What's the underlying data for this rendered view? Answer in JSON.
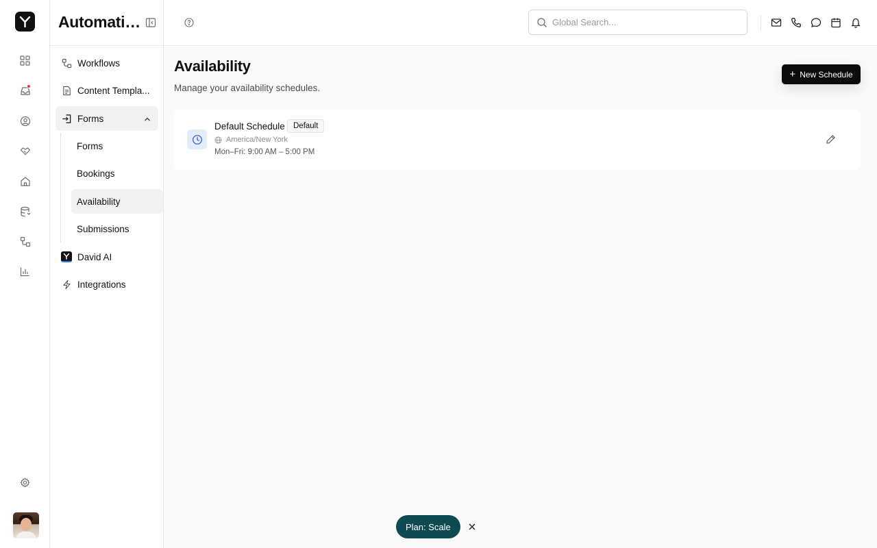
{
  "app": {
    "section_title": "Automatio..."
  },
  "rail": {
    "items": [
      {
        "icon": "dashboard-icon"
      },
      {
        "icon": "inbox-icon",
        "has_notification": true
      },
      {
        "icon": "contacts-icon"
      },
      {
        "icon": "deals-icon"
      },
      {
        "icon": "home-icon"
      },
      {
        "icon": "database-icon"
      },
      {
        "icon": "automation-icon"
      },
      {
        "icon": "reports-icon"
      }
    ],
    "settings_icon": "gear-icon"
  },
  "sidebar": {
    "items": [
      {
        "label": "Workflows",
        "icon": "workflow-icon"
      },
      {
        "label": "Content Templa...",
        "icon": "document-icon"
      },
      {
        "label": "Forms",
        "icon": "form-import-icon",
        "expanded": true
      },
      {
        "label": "David AI",
        "icon": "david-ai-logo-icon"
      },
      {
        "label": "Integrations",
        "icon": "lightning-icon"
      }
    ],
    "forms_children": [
      {
        "label": "Forms"
      },
      {
        "label": "Bookings"
      },
      {
        "label": "Availability",
        "active": true
      },
      {
        "label": "Submissions"
      }
    ]
  },
  "header": {
    "search_placeholder": "Global Search...",
    "icons": [
      "mail-icon",
      "phone-icon",
      "chat-icon",
      "calendar-icon",
      "bell-icon"
    ]
  },
  "page": {
    "title": "Availability",
    "subtitle": "Manage your availability schedules.",
    "new_button_label": "New Schedule"
  },
  "schedules": [
    {
      "name": "Default Schedule",
      "badge": "Default",
      "timezone": "America/New York",
      "hours": "Mon–Fri: 9:00 AM – 5:00 PM"
    }
  ],
  "plan": {
    "label": "Plan: Scale"
  },
  "colors": {
    "primary_button": "#0b0b0c",
    "plan_pill": "#0f4a51",
    "notification_dot": "#e5393b",
    "schedule_icon_bg": "#e3ecfb",
    "schedule_icon": "#3b6fd6"
  }
}
